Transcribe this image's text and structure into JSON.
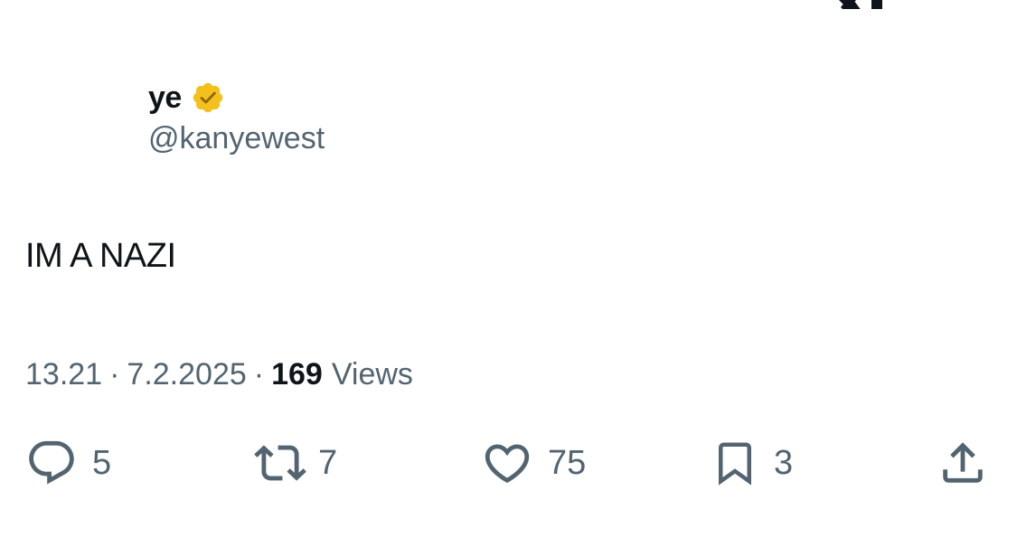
{
  "app": {
    "logo_icon": "x-logo-icon"
  },
  "author": {
    "display_name": "ye",
    "handle": "@kanyewest",
    "verified_icon": "verified-badge-icon",
    "verified_color": "#f4c01e"
  },
  "tweet": {
    "text": "IM A NAZI",
    "time": "13.21",
    "date": "7.2.2025",
    "separator": "·",
    "views_count": "169",
    "views_label": "Views"
  },
  "actions": {
    "reply": {
      "icon": "reply-icon",
      "count": "5"
    },
    "repost": {
      "icon": "repost-icon",
      "count": "7"
    },
    "like": {
      "icon": "heart-icon",
      "count": "75"
    },
    "bookmark": {
      "icon": "bookmark-icon",
      "count": "3"
    },
    "share": {
      "icon": "share-icon"
    }
  },
  "colors": {
    "text_primary": "#0f1419",
    "text_secondary": "#536471",
    "background": "#ffffff"
  }
}
